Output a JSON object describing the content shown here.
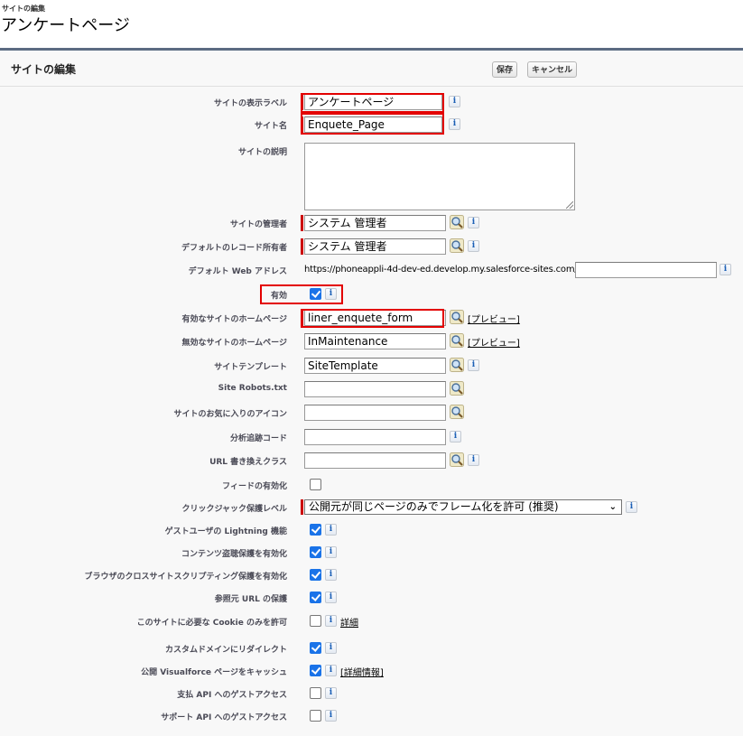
{
  "header": {
    "breadcrumb": "サイトの編集",
    "title": "アンケートページ"
  },
  "panel": {
    "title": "サイトの編集",
    "save_label": "保存",
    "cancel_label": "キャンセル"
  },
  "fields": {
    "display_label": {
      "label": "サイトの表示ラベル",
      "value": "アンケートページ",
      "required": true
    },
    "site_name": {
      "label": "サイト名",
      "value": "Enquete_Page",
      "required": true
    },
    "description": {
      "label": "サイトの説明",
      "value": ""
    },
    "site_admin": {
      "label": "サイトの管理者",
      "value": "システム 管理者",
      "required": true
    },
    "default_record_owner": {
      "label": "デフォルトのレコード所有者",
      "value": "システム 管理者",
      "required": true
    },
    "default_web_address": {
      "label": "デフォルト Web アドレス",
      "prefix": "https://phoneappli-4d-dev-ed.develop.my.salesforce-sites.com/",
      "value": ""
    },
    "active": {
      "label": "有効",
      "checked": true
    },
    "active_home": {
      "label": "有効なサイトのホームページ",
      "value": "liner_enquete_form",
      "preview_label": "[プレビュー]",
      "required": true
    },
    "inactive_home": {
      "label": "無効なサイトのホームページ",
      "value": "InMaintenance",
      "preview_label": "[プレビュー]"
    },
    "site_template": {
      "label": "サイトテンプレート",
      "value": "SiteTemplate"
    },
    "robots": {
      "label": "Site Robots.txt",
      "value": ""
    },
    "favorite_icon": {
      "label": "サイトのお気に入りのアイコン",
      "value": ""
    },
    "analytics": {
      "label": "分析追跡コード",
      "value": ""
    },
    "url_rewriter": {
      "label": "URL 書き換えクラス",
      "value": ""
    },
    "enable_feeds": {
      "label": "フィードの有効化",
      "checked": false
    },
    "clickjack": {
      "label": "クリックジャック保護レベル",
      "selected": "公開元が同じページのみでフレーム化を許可 (推奨)"
    },
    "guest_lightning": {
      "label": "ゲストユーザの Lightning 機能",
      "checked": true
    },
    "content_sniffing": {
      "label": "コンテンツ盗聴保護を有効化",
      "checked": true
    },
    "xss_protection": {
      "label": "ブラウザのクロスサイトスクリプティング保護を有効化",
      "checked": true
    },
    "referrer": {
      "label": "参照元 URL の保護",
      "checked": true
    },
    "cookies": {
      "label": "このサイトに必要な Cookie のみを許可",
      "checked": false,
      "link_label": "詳細"
    },
    "custom_domain": {
      "label": "カスタムドメインにリダイレクト",
      "checked": true
    },
    "vf_cache": {
      "label": "公開 Visualforce ページをキャッシュ",
      "checked": true,
      "link_label": "[詳細情報]"
    },
    "payment_api": {
      "label": "支払 API へのゲストアクセス",
      "checked": false
    },
    "support_api": {
      "label": "サポート API へのゲストアクセス",
      "checked": false
    }
  },
  "icons": {
    "info": "i",
    "select_arrow": "❯"
  },
  "colors": {
    "required": "#cc0000",
    "highlight_box": "#e30000",
    "checkbox": "#1a73e8",
    "panel_border": "#5b6b82"
  }
}
